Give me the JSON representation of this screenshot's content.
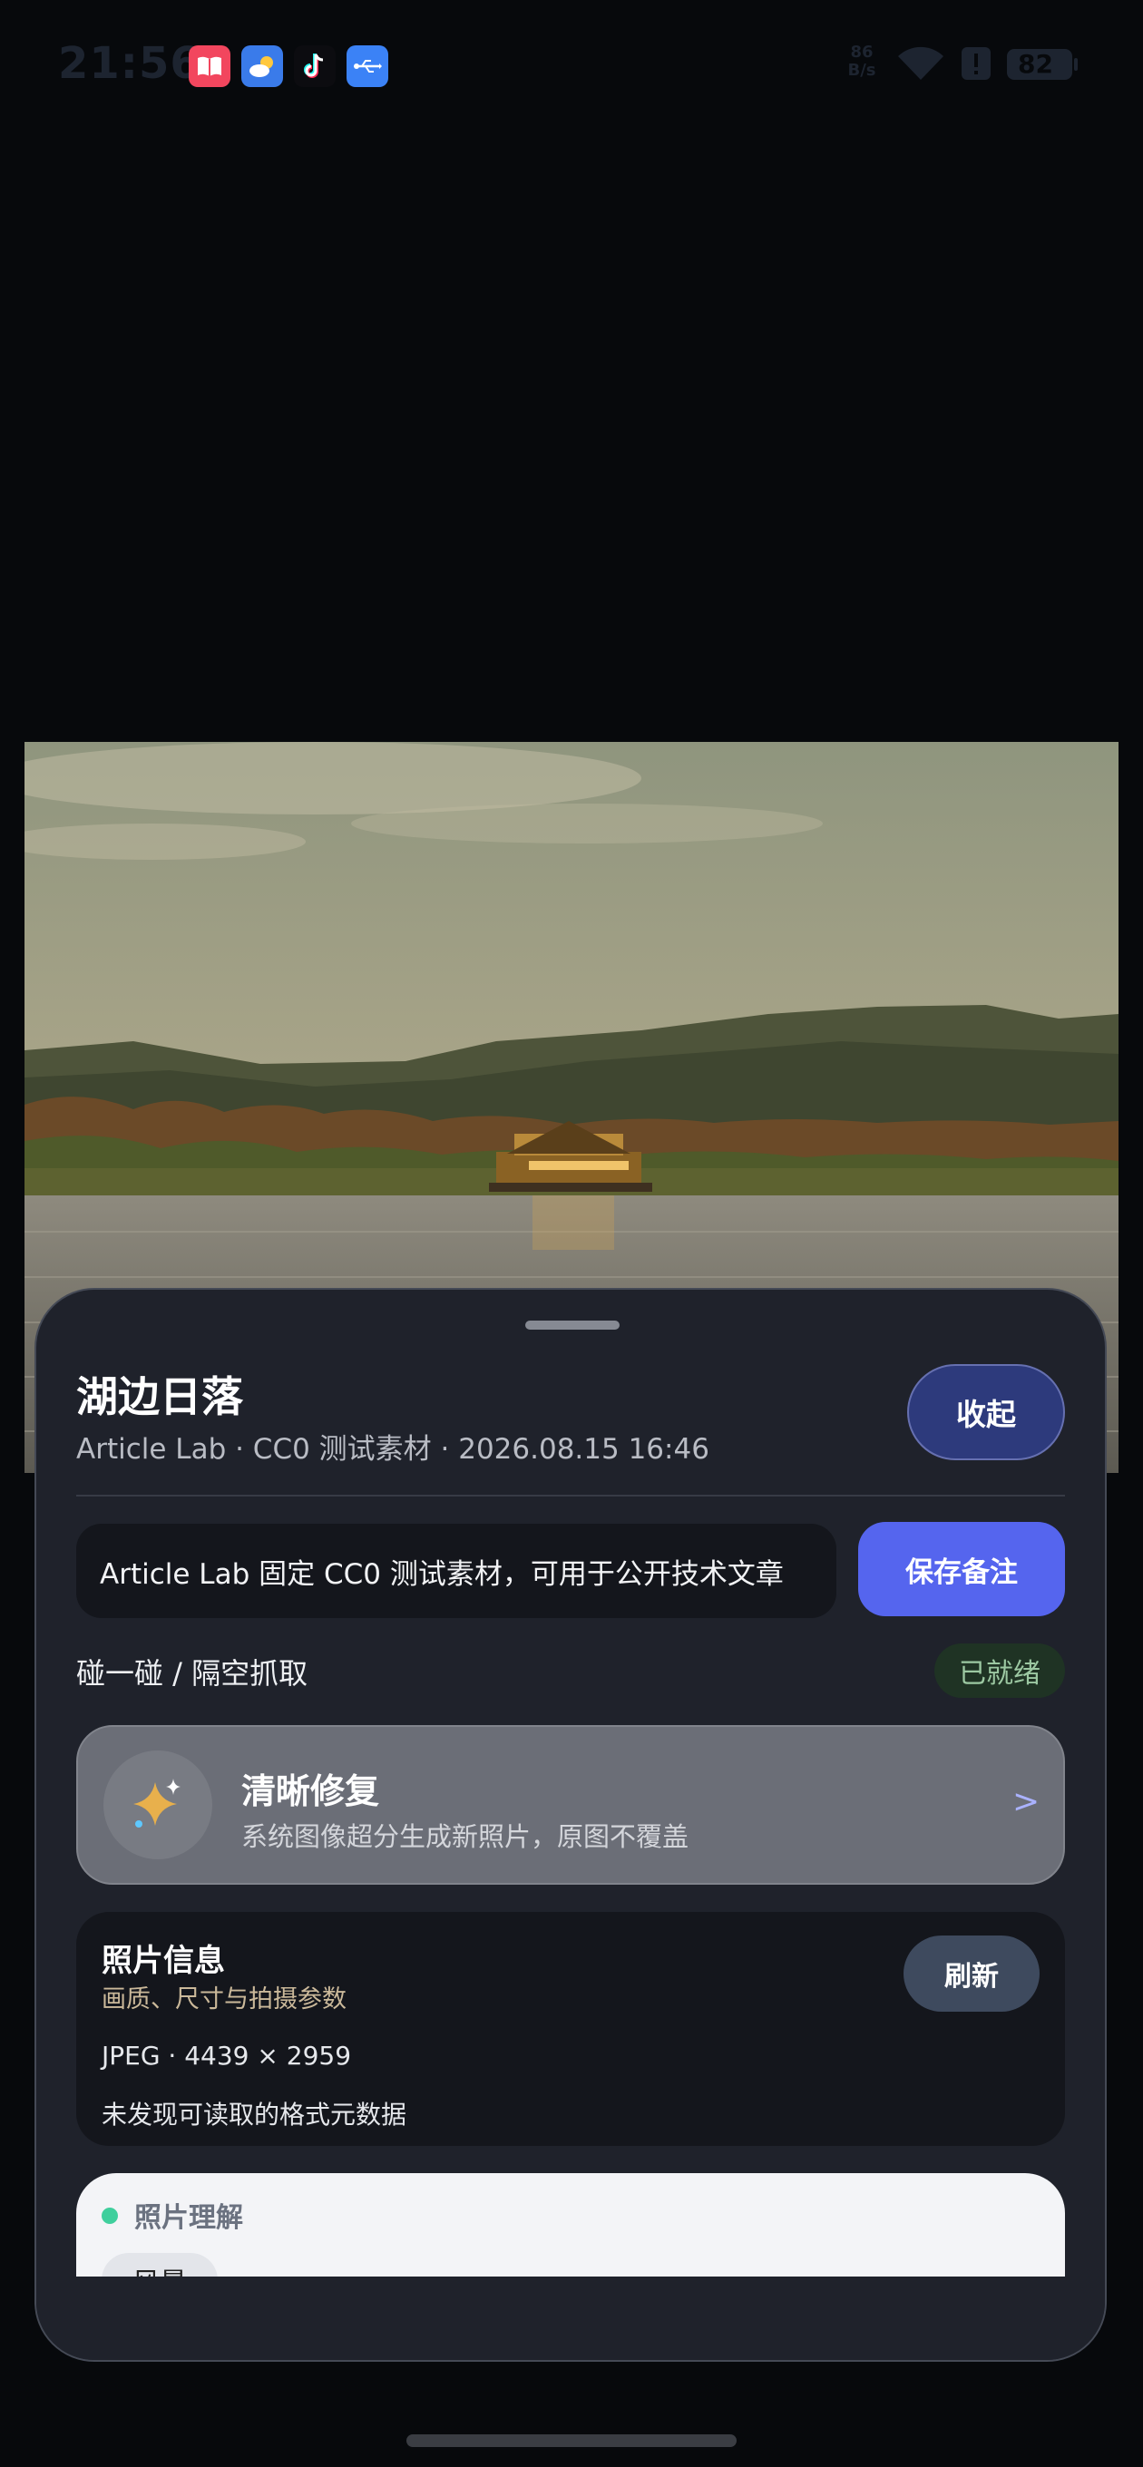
{
  "status_bar": {
    "time": "21:56",
    "net_speed_top": "86",
    "net_speed_bottom": "B/s",
    "battery": "82",
    "app_icons": [
      "books-icon",
      "weather-icon",
      "tiktok-icon",
      "usb-icon"
    ]
  },
  "photo": {
    "description_icon": "lake-sunset-photo"
  },
  "sheet": {
    "title": "湖边日落",
    "meta": "Article Lab · CC0 测试素材 · 2026.08.15 16:46",
    "collapse_label": "收起",
    "note_value": "Article Lab 固定 CC0 测试素材，可用于公开技术文章",
    "save_label": "保存备注",
    "nfc_label": "碰一碰 / 隔空抓取",
    "ready_label": "已就绪",
    "restore": {
      "title": "清晰修复",
      "subtitle": "系统图像超分生成新照片，原图不覆盖",
      "arrow": ">"
    },
    "info": {
      "title": "照片信息",
      "subtitle": "画质、尺寸与拍摄参数",
      "refresh_label": "刷新",
      "format_line": "JPEG · 4439 × 2959",
      "metadata_line": "未发现可读取的格式元数据"
    },
    "understanding": {
      "title": "照片理解",
      "chip": "风景"
    }
  },
  "colors": {
    "accent": "#5565ee",
    "sheet_bg": "#1f222b",
    "ready_bg": "#1f3324",
    "ready_text": "#9cc8a2"
  }
}
